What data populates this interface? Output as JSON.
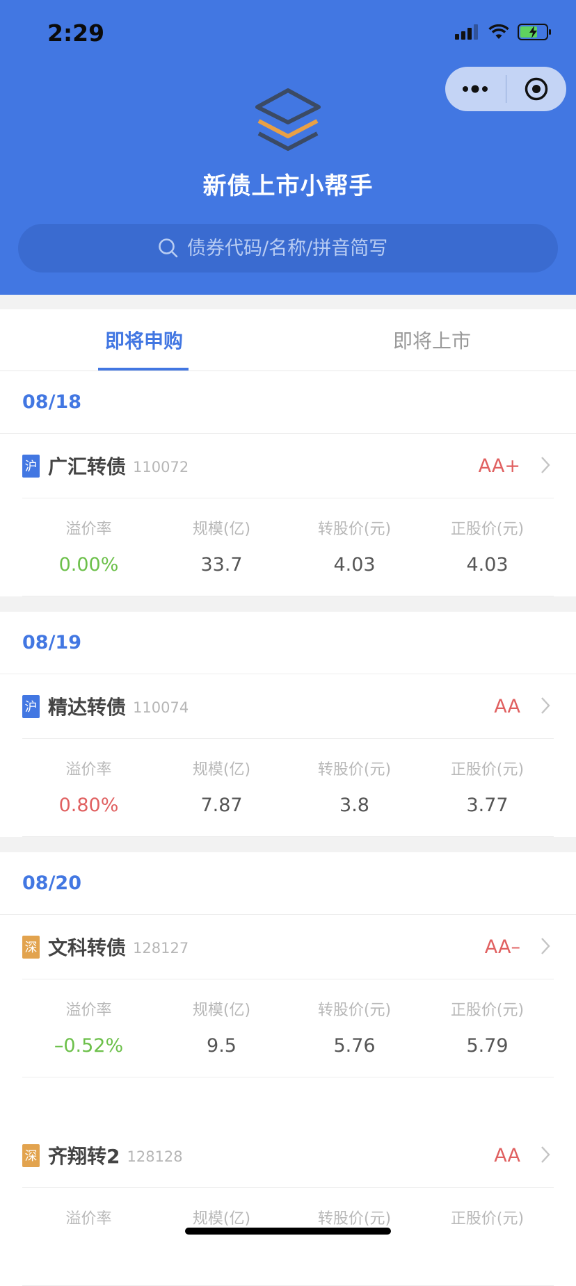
{
  "status": {
    "time": "2:29"
  },
  "app": {
    "title": "新债上市小帮手"
  },
  "search": {
    "placeholder": "债券代码/名称/拼音简写"
  },
  "tabs": [
    {
      "label": "即将申购"
    },
    {
      "label": "即将上市"
    }
  ],
  "stat_labels": {
    "premium": "溢价率",
    "scale": "规模(亿)",
    "conv_price": "转股价(元)",
    "stock_price": "正股价(元)"
  },
  "sections": [
    {
      "date": "08/18",
      "bonds": [
        {
          "market": "沪",
          "name": "广汇转债",
          "code": "110072",
          "rating": "AA+",
          "premium": "0.00%",
          "scale": "33.7",
          "conv_price": "4.03",
          "stock_price": "4.03"
        }
      ]
    },
    {
      "date": "08/19",
      "bonds": [
        {
          "market": "沪",
          "name": "精达转债",
          "code": "110074",
          "rating": "AA",
          "premium": "0.80%",
          "scale": "7.87",
          "conv_price": "3.8",
          "stock_price": "3.77"
        }
      ]
    },
    {
      "date": "08/20",
      "bonds": [
        {
          "market": "深",
          "name": "文科转债",
          "code": "128127",
          "rating": "AA–",
          "premium": "–0.52%",
          "scale": "9.5",
          "conv_price": "5.76",
          "stock_price": "5.79"
        },
        {
          "market": "深",
          "name": "齐翔转2",
          "code": "128128",
          "rating": "AA"
        }
      ]
    }
  ],
  "colors": {
    "header": "#4277e2",
    "positive": "#e06060",
    "negative": "#6cc04a",
    "market_sh": "#4277e2",
    "market_sz": "#e2a34e"
  }
}
